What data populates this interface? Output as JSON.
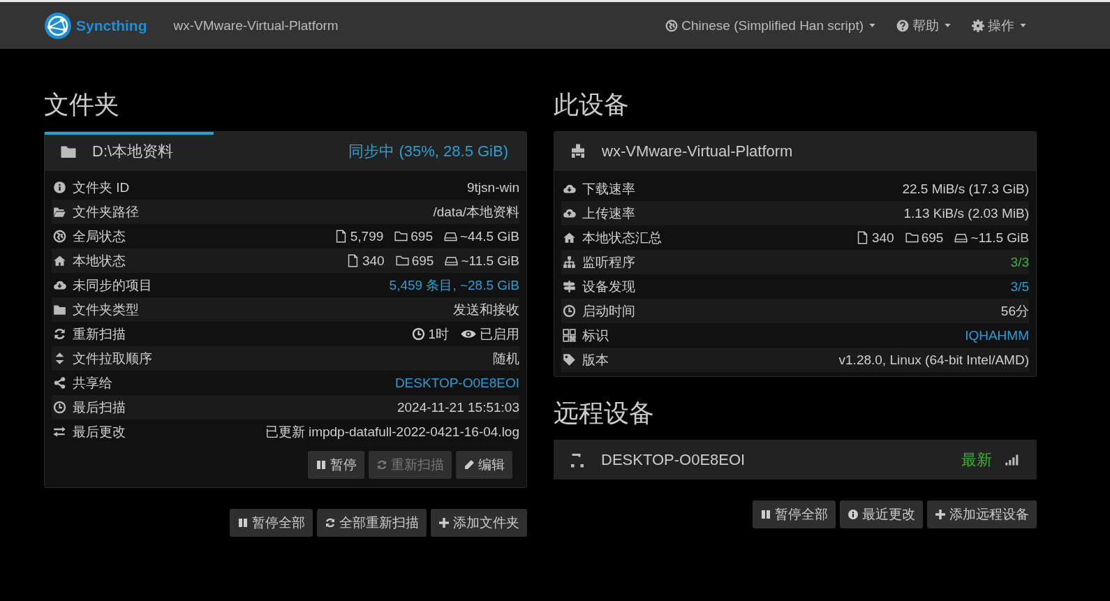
{
  "navbar": {
    "brand": "Syncthing",
    "device_name": "wx-VMware-Virtual-Platform",
    "menus": [
      {
        "label": "Chinese (Simplified Han script)"
      },
      {
        "label": "帮助"
      },
      {
        "label": "操作"
      }
    ]
  },
  "folders": {
    "heading": "文件夹",
    "folder": {
      "name": "D:\\本地资料",
      "status": "同步中 (35%, 28.5 GiB)",
      "level": 0.35,
      "rows": [
        {
          "kind": "text",
          "label": "文件夹 ID",
          "value": "9tjsn-win"
        },
        {
          "kind": "text",
          "label": "文件夹路径",
          "value": "/data/本地资料"
        },
        {
          "kind": "stats",
          "label": "全局状态",
          "files": "5,799",
          "dirs": "695",
          "size": "~44.5 GiB"
        },
        {
          "kind": "stats",
          "label": "本地状态",
          "files": "340",
          "dirs": "695",
          "size": "~11.5 GiB"
        },
        {
          "kind": "link",
          "label": "未同步的项目",
          "value": "5,459 条目, ~28.5 GiB"
        },
        {
          "kind": "text",
          "label": "文件夹类型",
          "value": "发送和接收"
        },
        {
          "kind": "rescan",
          "label": "重新扫描",
          "interval": "1时",
          "watch": "已启用"
        },
        {
          "kind": "text",
          "label": "文件拉取顺序",
          "value": "随机"
        },
        {
          "kind": "link",
          "label": "共享给",
          "value": "DESKTOP-O0E8EOI"
        },
        {
          "kind": "text",
          "label": "最后扫描",
          "value": "2024-11-21 15:51:03"
        },
        {
          "kind": "text",
          "label": "最后更改",
          "value": "已更新 impdp-datafull-2022-0421-16-04.log"
        }
      ],
      "buttons": [
        {
          "label": "暂停",
          "disabled": false
        },
        {
          "label": "重新扫描",
          "disabled": true
        },
        {
          "label": "编辑",
          "disabled": false
        }
      ]
    },
    "buttons": [
      {
        "label": "暂停全部"
      },
      {
        "label": "全部重新扫描"
      },
      {
        "label": "添加文件夹"
      }
    ]
  },
  "this_device": {
    "heading": "此设备",
    "name": "wx-VMware-Virtual-Platform",
    "rows": [
      {
        "kind": "text",
        "label": "下载速率",
        "value": "22.5 MiB/s (17.3 GiB)"
      },
      {
        "kind": "text",
        "label": "上传速率",
        "value": "1.13 KiB/s (2.03 MiB)"
      },
      {
        "kind": "stats",
        "label": "本地状态汇总",
        "files": "340",
        "dirs": "695",
        "size": "~11.5 GiB"
      },
      {
        "kind": "ok",
        "label": "监听程序",
        "value": "3/3"
      },
      {
        "kind": "link",
        "label": "设备发现",
        "value": "3/5"
      },
      {
        "kind": "text",
        "label": "启动时间",
        "value": "56分"
      },
      {
        "kind": "link",
        "label": "标识",
        "value": "IQHAHMM"
      },
      {
        "kind": "text",
        "label": "版本",
        "value": "v1.28.0, Linux (64-bit Intel/AMD)"
      }
    ]
  },
  "remote_devices": {
    "heading": "远程设备",
    "devices": [
      {
        "name": "DESKTOP-O0E8EOI",
        "status": "最新"
      }
    ],
    "buttons": [
      {
        "label": "暂停全部"
      },
      {
        "label": "最近更改"
      },
      {
        "label": "添加远程设备"
      }
    ]
  }
}
